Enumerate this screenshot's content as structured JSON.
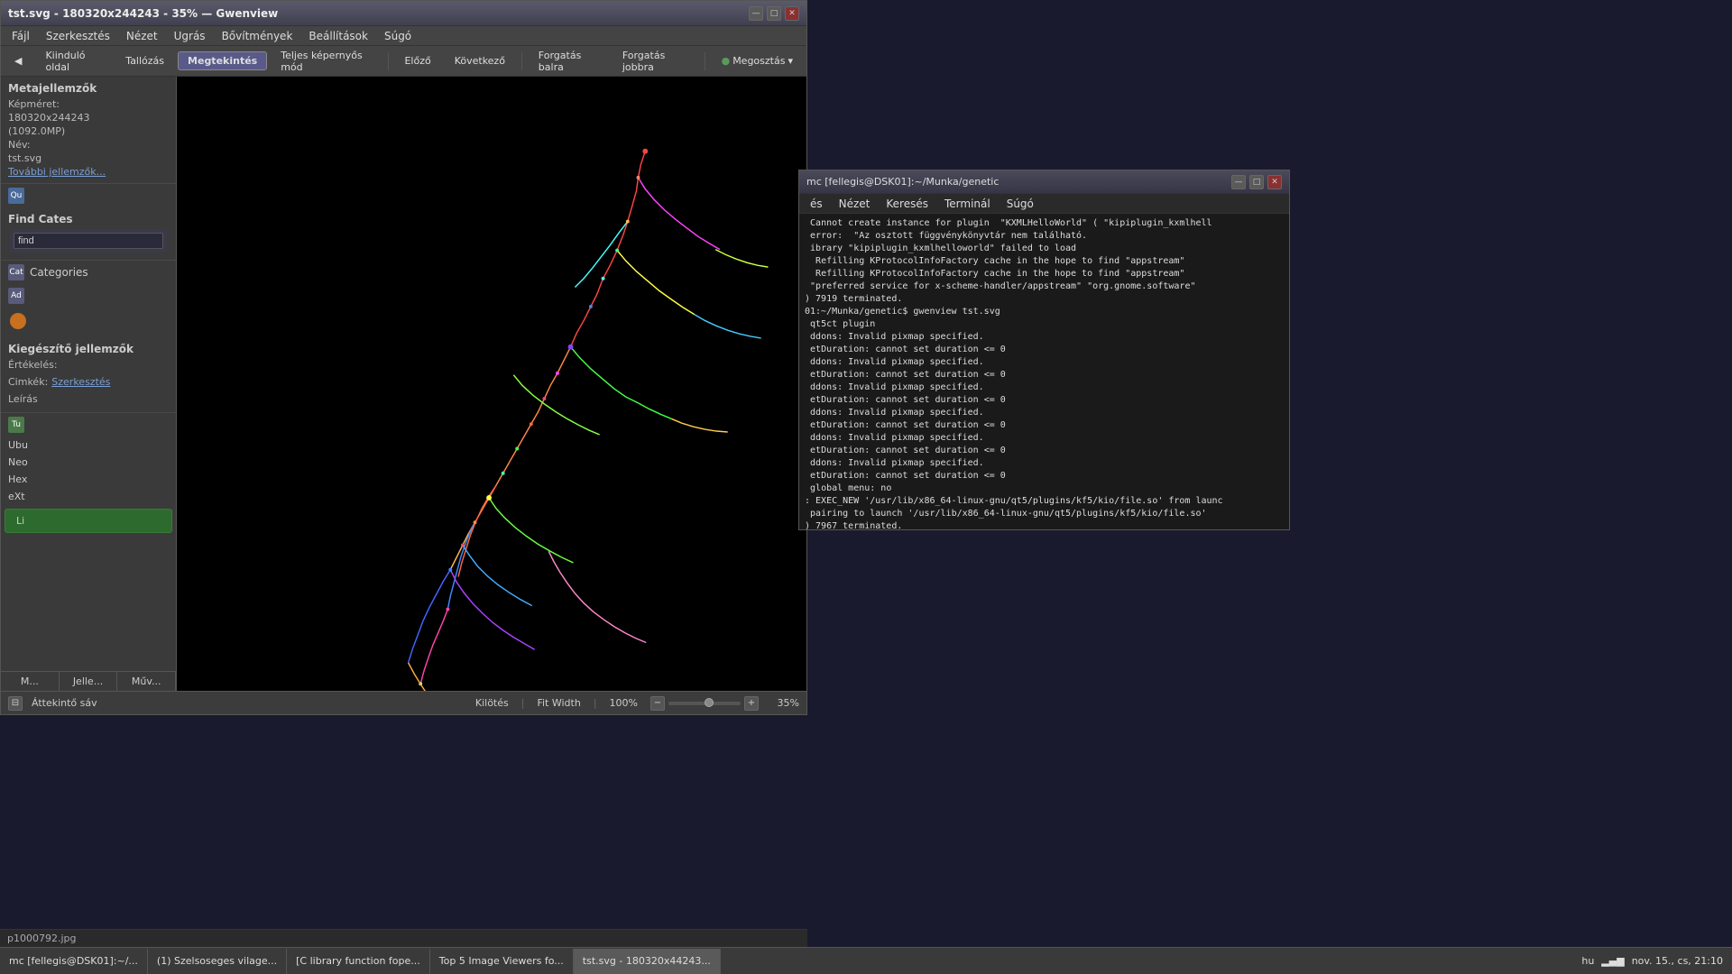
{
  "gwenview": {
    "titlebar": {
      "title": "tst.svg - 180320x244243 - 35% — Gwenview",
      "minimize_label": "_",
      "maximize_label": "□",
      "close_label": "×"
    },
    "menu": {
      "items": [
        "Fájl",
        "Szerkesztés",
        "Nézet",
        "Ugrás",
        "Bővítmények",
        "Beállítások",
        "Súgó"
      ]
    },
    "toolbar": {
      "items": [
        "Kiinduló oldal",
        "Tallózás",
        "Megtekintés",
        "Teljes képernyős mód",
        "Előző",
        "Következő",
        "Forgatás balra",
        "Forgatás jobbra",
        "Megosztás"
      ]
    },
    "sidebar": {
      "meta_title": "Metajellemzők",
      "image_size_label": "Képméret:",
      "image_size_value": "180320x244243",
      "image_size_mp": "(1092.0MP)",
      "name_label": "Név:",
      "name_value": "tst.svg",
      "more_link": "További jellemzők...",
      "quick_panel": "Qu",
      "find_panel_title": "Find Cates",
      "find_input": "find",
      "categories_title": "Cat",
      "categories_label": "Categories",
      "add_btn": "Ad",
      "supplementary_title": "Kiegészítő jellemzők",
      "rating_label": "Értékelés:",
      "tags_label": "Cimkék:",
      "tags_link": "Szerkesztés",
      "description_label": "Leírás",
      "tutorial_panel": "Tu",
      "ubuntu_label": "Ubu",
      "neo_label": "Neo",
      "hex_label": "Hex",
      "extensions_label": "eXt",
      "list_panel": "Li",
      "bottom_tabs": [
        "M...",
        "Jelle...",
        "Műv..."
      ]
    },
    "status_bar": {
      "thumbnail_label": "Áttekintő sáv",
      "fit_out": "Kilötés",
      "fit_width": "Fit Width",
      "zoom_percent": "100%",
      "zoom_value": "35%"
    },
    "bottom_image": "p1000792.jpg"
  },
  "terminal": {
    "titlebar": "mc [fellegis@DSK01]:~/Munka/genetic",
    "minimize_label": "_",
    "maximize_label": "□",
    "close_label": "×",
    "menu": {
      "items": [
        "és",
        "Nézet",
        "Keresés",
        "Terminál",
        "Súgó"
      ]
    },
    "lines": [
      " Cannot create instance for plugin  \"KXMLHelloWorld\" ( \"kipiplugin_kxmlhell",
      " error:  \"Az osztott függvénykönyvtár nem található.",
      " ibrary \"kipiplugin_kxmlhelloworld\" failed to load",
      "  Refilling KProtocolInfoFactory cache in the hope to find \"appstream\"",
      "  Refilling KProtocolInfoFactory cache in the hope to find \"appstream\"",
      " \"preferred service for x-scheme-handler/appstream\" \"org.gnome.software\"",
      ") 7919 terminated.",
      "01:~/Munka/genetic$ gwenview tst.svg",
      " qt5ct plugin",
      " ddons: Invalid pixmap specified.",
      " etDuration: cannot set duration <= 0",
      " ddons: Invalid pixmap specified.",
      " etDuration: cannot set duration <= 0",
      " ddons: Invalid pixmap specified.",
      " etDuration: cannot set duration <= 0",
      " ddons: Invalid pixmap specified.",
      " etDuration: cannot set duration <= 0",
      " ddons: Invalid pixmap specified.",
      " etDuration: cannot set duration <= 0",
      " ddons: Invalid pixmap specified.",
      " etDuration: cannot set duration <= 0",
      " global menu: no",
      ": EXEC_NEW '/usr/lib/x86_64-linux-gnu/qt5/plugins/kf5/kio/file.so' from launc",
      " pairing to launch '/usr/lib/x86_64-linux-gnu/qt5/plugins/kf5/kio/file.so'",
      ") 7967 terminated."
    ]
  },
  "taskbar": {
    "items": [
      {
        "label": "mc [fellegis@DSK01]:~/..."
      },
      {
        "label": "(1) Szelsoseges vilage..."
      },
      {
        "label": "[C library function fope..."
      },
      {
        "label": "Top 5 Image Viewers fo..."
      },
      {
        "label": "tst.svg - 180320x44243..."
      }
    ],
    "tray": {
      "lang": "hu",
      "signal_bars": "▂▄▆",
      "datetime": "nov. 15., cs, 21:10"
    }
  },
  "icons": {
    "minimize": "—",
    "maximize": "□",
    "close": "✕",
    "back": "◀",
    "share": "🔗",
    "thumbnail": "⊟",
    "zoom_minus": "−",
    "zoom_plus": "+"
  }
}
